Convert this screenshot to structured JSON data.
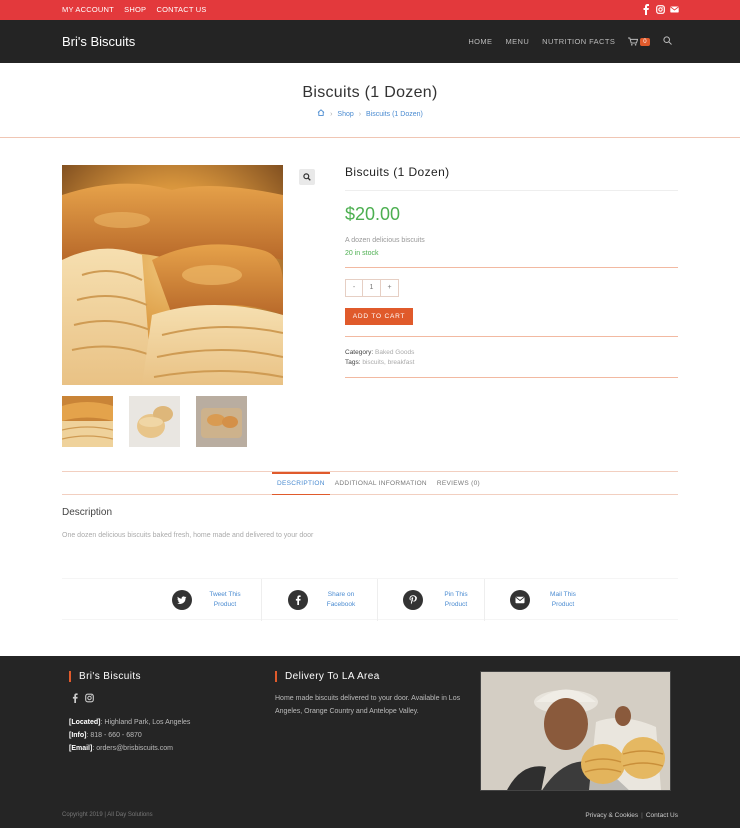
{
  "topbar": {
    "my_account": "MY ACCOUNT",
    "shop": "SHOP",
    "contact": "CONTACT US",
    "social_icons": [
      "facebook-icon",
      "instagram-icon",
      "mail-icon"
    ],
    "background": "#e3393c"
  },
  "header": {
    "brand": "Bri's Biscuits",
    "nav": [
      "HOME",
      "MENU",
      "NUTRITION FACTS"
    ],
    "cart_count": "0",
    "background": "#242424"
  },
  "page_header": {
    "title": "Biscuits (1 Dozen)",
    "breadcrumb": [
      "Shop",
      "Biscuits (1 Dozen)"
    ]
  },
  "product": {
    "title": "Biscuits (1 Dozen)",
    "price": "$20.00",
    "short_description": "A dozen delicious biscuits",
    "stock": "20 in stock",
    "qty_minus": "-",
    "qty_value": "1",
    "qty_plus": "+",
    "add_to_cart": "ADD TO CART",
    "category_label": "Category:",
    "category": "Baked Goods",
    "tags_label": "Tags:",
    "tags": "biscuits, breakfast",
    "price_color": "#4caf50",
    "accent_color": "#e05a2b"
  },
  "tabs": {
    "items": [
      "DESCRIPTION",
      "ADDITIONAL INFORMATION",
      "REVIEWS (0)"
    ],
    "active": "DESCRIPTION"
  },
  "description": {
    "heading": "Description",
    "text": "One dozen delicious biscuits baked fresh, home made and delivered to your door"
  },
  "share": [
    {
      "line1": "Tweet This",
      "line2": "Product",
      "icon": "twitter-icon"
    },
    {
      "line1": "Share on",
      "line2": "Facebook",
      "icon": "facebook-icon"
    },
    {
      "line1": "Pin This",
      "line2": "Product",
      "icon": "pinterest-icon"
    },
    {
      "line1": "Mail This",
      "line2": "Product",
      "icon": "mail-icon"
    }
  ],
  "footer": {
    "col1_heading": "Bri's Biscuits",
    "located_label": "[Located]",
    "located": ": Highland Park, Los Angeles",
    "info_label": "[Info]",
    "info": ": 818 - 660 - 6870",
    "email_label": "[Email]",
    "email": ": orders@brisbiscuits.com",
    "col2_heading": "Delivery To LA Area",
    "col2_text": "Home made biscuits delivered to your door. Available in Los Angeles, Orange Country and Antelope Valley.",
    "copyright": "Copyright 2019 | All Day Solutions",
    "links": [
      "Privacy & Cookies",
      "Contact Us"
    ]
  }
}
